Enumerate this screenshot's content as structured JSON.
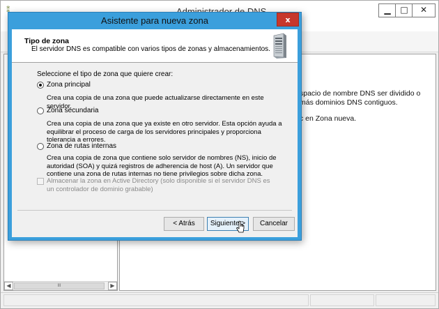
{
  "background_window": {
    "title": "Administrador de DNS",
    "minimize_symbol": "▁",
    "maximize_symbol": "□",
    "close_symbol": "✕",
    "right_pane_text_1": "spacio de nombre DNS ser dividido o más dominios DNS contiguos.",
    "right_pane_text_2": "c en Zona nueva.",
    "scroll_thumb_grip": "III"
  },
  "dialog": {
    "title": "Asistente para nueva zona",
    "close_symbol": "x",
    "header_title": "Tipo de zona",
    "header_description": "El servidor DNS es compatible con varios tipos de zonas y almacenamientos.",
    "question": "Seleccione el tipo de zona que quiere crear:",
    "options": [
      {
        "label": "Zona principal",
        "description": "Crea una copia de una zona que puede actualizarse directamente en este servidor.",
        "selected": true
      },
      {
        "label": "Zona secundaria",
        "description": "Crea una copia de una zona que ya existe en otro servidor. Esta opción ayuda a equilibrar el proceso de carga de los servidores principales y proporciona tolerancia a errores.",
        "selected": false
      },
      {
        "label": "Zona de rutas internas",
        "description": "Crea una copia de zona que contiene solo servidor de nombres (NS), inicio de autoridad (SOA) y quizá registros de adherencia de host (A). Un servidor que contiene una zona de rutas internas no tiene privilegios sobre dicha zona.",
        "selected": false
      }
    ],
    "ad_checkbox_label": "Almacenar la zona en Active Directory (solo disponible si el servidor DNS es un controlador de dominio grabable)",
    "ad_checkbox_enabled": false,
    "buttons": {
      "back": "< Atrás",
      "next": "Siguiente >",
      "cancel": "Cancelar"
    }
  },
  "colors": {
    "dialog_frame": "#3b9fdc",
    "close_button": "#c7372c",
    "default_button_border": "#3c7fb1"
  }
}
